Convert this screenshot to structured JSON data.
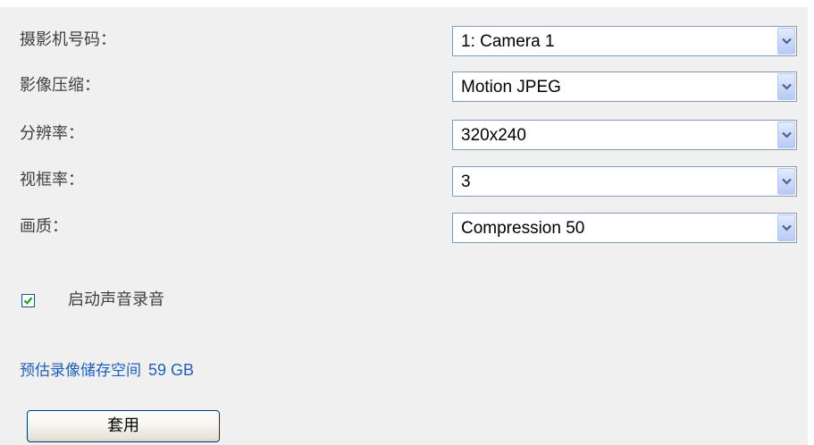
{
  "settings": [
    {
      "label": "摄影机号码：",
      "value": "1: Camera 1"
    },
    {
      "label": "影像压缩：",
      "value": "Motion JPEG"
    },
    {
      "label": "分辨率：",
      "value": "320x240"
    },
    {
      "label": "视框率：",
      "value": "3"
    },
    {
      "label": "画质：",
      "value": "Compression 50"
    }
  ],
  "audio": {
    "label": "启动声音录音",
    "checked": true
  },
  "storage": {
    "label": "预估录像储存空间",
    "value": "59 GB"
  },
  "apply_label": "套用",
  "colors": {
    "panel_bg": "#f0f0f0",
    "label_text": "#404040",
    "storage_text": "#1f5fbf",
    "select_border": "#7f9db9",
    "dropdown_button": "#c9d8fb",
    "check_mark": "#21a121"
  },
  "icons": {
    "dropdown": "chevron-down-icon",
    "check": "checkmark-icon"
  }
}
